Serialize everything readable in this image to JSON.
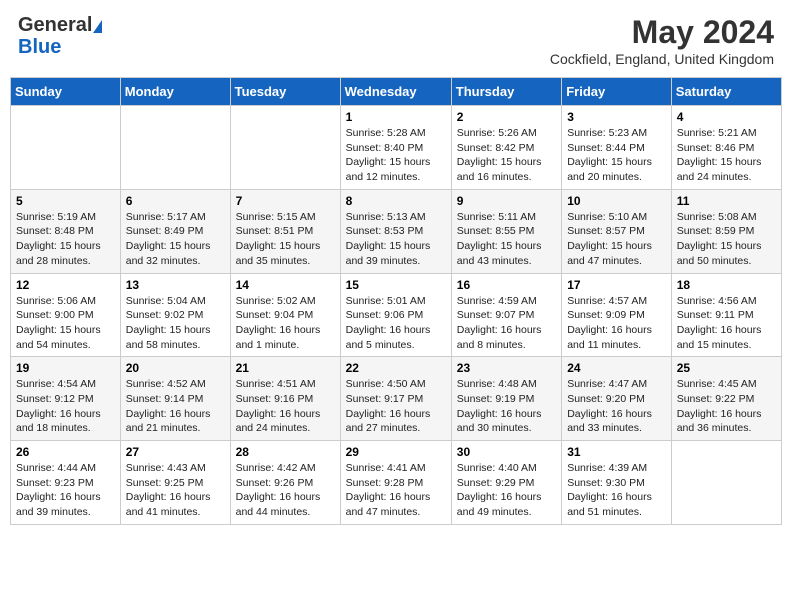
{
  "logo": {
    "general": "General",
    "blue": "Blue"
  },
  "title": "May 2024",
  "location": "Cockfield, England, United Kingdom",
  "days_of_week": [
    "Sunday",
    "Monday",
    "Tuesday",
    "Wednesday",
    "Thursday",
    "Friday",
    "Saturday"
  ],
  "weeks": [
    [
      {
        "day": "",
        "info": ""
      },
      {
        "day": "",
        "info": ""
      },
      {
        "day": "",
        "info": ""
      },
      {
        "day": "1",
        "info": "Sunrise: 5:28 AM\nSunset: 8:40 PM\nDaylight: 15 hours\nand 12 minutes."
      },
      {
        "day": "2",
        "info": "Sunrise: 5:26 AM\nSunset: 8:42 PM\nDaylight: 15 hours\nand 16 minutes."
      },
      {
        "day": "3",
        "info": "Sunrise: 5:23 AM\nSunset: 8:44 PM\nDaylight: 15 hours\nand 20 minutes."
      },
      {
        "day": "4",
        "info": "Sunrise: 5:21 AM\nSunset: 8:46 PM\nDaylight: 15 hours\nand 24 minutes."
      }
    ],
    [
      {
        "day": "5",
        "info": "Sunrise: 5:19 AM\nSunset: 8:48 PM\nDaylight: 15 hours\nand 28 minutes."
      },
      {
        "day": "6",
        "info": "Sunrise: 5:17 AM\nSunset: 8:49 PM\nDaylight: 15 hours\nand 32 minutes."
      },
      {
        "day": "7",
        "info": "Sunrise: 5:15 AM\nSunset: 8:51 PM\nDaylight: 15 hours\nand 35 minutes."
      },
      {
        "day": "8",
        "info": "Sunrise: 5:13 AM\nSunset: 8:53 PM\nDaylight: 15 hours\nand 39 minutes."
      },
      {
        "day": "9",
        "info": "Sunrise: 5:11 AM\nSunset: 8:55 PM\nDaylight: 15 hours\nand 43 minutes."
      },
      {
        "day": "10",
        "info": "Sunrise: 5:10 AM\nSunset: 8:57 PM\nDaylight: 15 hours\nand 47 minutes."
      },
      {
        "day": "11",
        "info": "Sunrise: 5:08 AM\nSunset: 8:59 PM\nDaylight: 15 hours\nand 50 minutes."
      }
    ],
    [
      {
        "day": "12",
        "info": "Sunrise: 5:06 AM\nSunset: 9:00 PM\nDaylight: 15 hours\nand 54 minutes."
      },
      {
        "day": "13",
        "info": "Sunrise: 5:04 AM\nSunset: 9:02 PM\nDaylight: 15 hours\nand 58 minutes."
      },
      {
        "day": "14",
        "info": "Sunrise: 5:02 AM\nSunset: 9:04 PM\nDaylight: 16 hours\nand 1 minute."
      },
      {
        "day": "15",
        "info": "Sunrise: 5:01 AM\nSunset: 9:06 PM\nDaylight: 16 hours\nand 5 minutes."
      },
      {
        "day": "16",
        "info": "Sunrise: 4:59 AM\nSunset: 9:07 PM\nDaylight: 16 hours\nand 8 minutes."
      },
      {
        "day": "17",
        "info": "Sunrise: 4:57 AM\nSunset: 9:09 PM\nDaylight: 16 hours\nand 11 minutes."
      },
      {
        "day": "18",
        "info": "Sunrise: 4:56 AM\nSunset: 9:11 PM\nDaylight: 16 hours\nand 15 minutes."
      }
    ],
    [
      {
        "day": "19",
        "info": "Sunrise: 4:54 AM\nSunset: 9:12 PM\nDaylight: 16 hours\nand 18 minutes."
      },
      {
        "day": "20",
        "info": "Sunrise: 4:52 AM\nSunset: 9:14 PM\nDaylight: 16 hours\nand 21 minutes."
      },
      {
        "day": "21",
        "info": "Sunrise: 4:51 AM\nSunset: 9:16 PM\nDaylight: 16 hours\nand 24 minutes."
      },
      {
        "day": "22",
        "info": "Sunrise: 4:50 AM\nSunset: 9:17 PM\nDaylight: 16 hours\nand 27 minutes."
      },
      {
        "day": "23",
        "info": "Sunrise: 4:48 AM\nSunset: 9:19 PM\nDaylight: 16 hours\nand 30 minutes."
      },
      {
        "day": "24",
        "info": "Sunrise: 4:47 AM\nSunset: 9:20 PM\nDaylight: 16 hours\nand 33 minutes."
      },
      {
        "day": "25",
        "info": "Sunrise: 4:45 AM\nSunset: 9:22 PM\nDaylight: 16 hours\nand 36 minutes."
      }
    ],
    [
      {
        "day": "26",
        "info": "Sunrise: 4:44 AM\nSunset: 9:23 PM\nDaylight: 16 hours\nand 39 minutes."
      },
      {
        "day": "27",
        "info": "Sunrise: 4:43 AM\nSunset: 9:25 PM\nDaylight: 16 hours\nand 41 minutes."
      },
      {
        "day": "28",
        "info": "Sunrise: 4:42 AM\nSunset: 9:26 PM\nDaylight: 16 hours\nand 44 minutes."
      },
      {
        "day": "29",
        "info": "Sunrise: 4:41 AM\nSunset: 9:28 PM\nDaylight: 16 hours\nand 47 minutes."
      },
      {
        "day": "30",
        "info": "Sunrise: 4:40 AM\nSunset: 9:29 PM\nDaylight: 16 hours\nand 49 minutes."
      },
      {
        "day": "31",
        "info": "Sunrise: 4:39 AM\nSunset: 9:30 PM\nDaylight: 16 hours\nand 51 minutes."
      },
      {
        "day": "",
        "info": ""
      }
    ]
  ]
}
